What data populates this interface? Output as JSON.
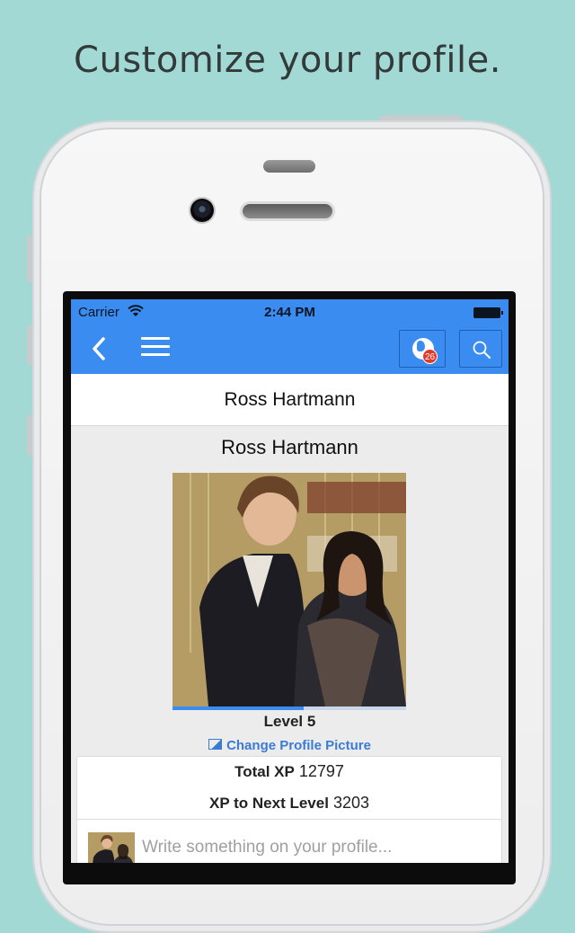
{
  "headline": "Customize your profile.",
  "status_bar": {
    "carrier": "Carrier",
    "time": "2:44 PM"
  },
  "nav": {
    "back_icon": "chevron-left-icon",
    "menu_icon": "hamburger-menu-icon",
    "notification_icon": "globe-icon",
    "notification_count": "26",
    "search_icon": "search-icon"
  },
  "page_title": "Ross Hartmann",
  "profile": {
    "name": "Ross Hartmann",
    "level": "Level 5",
    "level_progress": 0.56,
    "change_picture_label": "Change Profile Picture",
    "total_xp_label": "Total XP",
    "total_xp_value": "12797",
    "next_level_label": "XP to Next Level",
    "next_level_value": "3203"
  },
  "post": {
    "placeholder": "Write something on your profile..."
  },
  "colors": {
    "background": "#a3d9d5",
    "nav_blue": "#3a8cf0",
    "link_blue": "#3a7bd5",
    "badge_red": "#e23a2a"
  }
}
